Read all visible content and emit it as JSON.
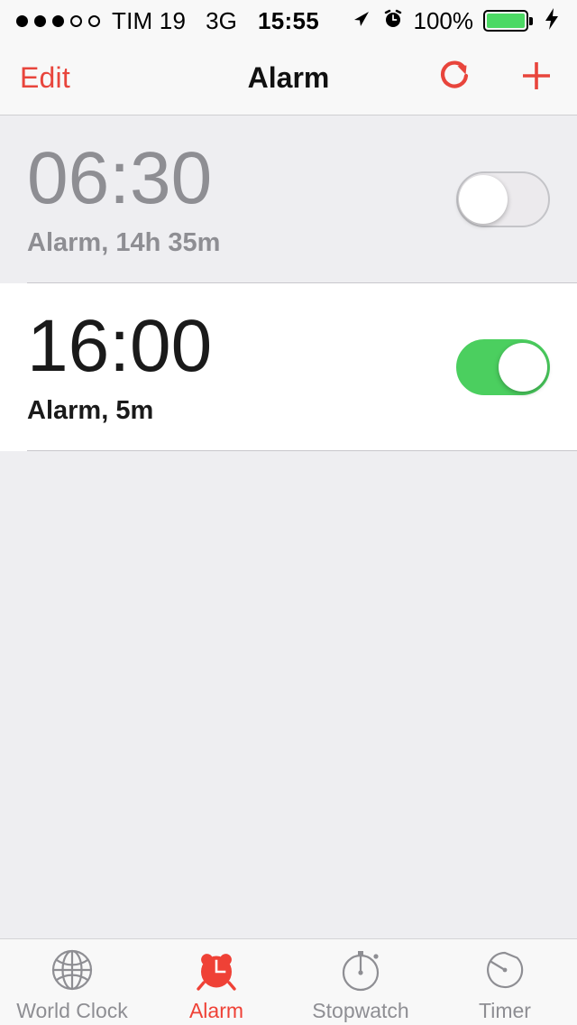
{
  "status_bar": {
    "signal_dots_total": 5,
    "signal_dots_filled": 3,
    "carrier": "TIM 19",
    "network": "3G",
    "time": "15:55",
    "battery_percent": "100%",
    "battery_level": 100,
    "charging": true,
    "location_icon": "location-arrow-icon",
    "alarm_icon": "alarm-clock-icon",
    "battery_color": "#4cd964"
  },
  "nav_bar": {
    "edit_label": "Edit",
    "title": "Alarm",
    "refresh_icon": "refresh-icon",
    "add_icon": "plus-icon",
    "accent_color": "#e8453c"
  },
  "alarms": [
    {
      "time": "06:30",
      "subtitle": "Alarm, 14h 35m",
      "enabled": false,
      "toggle_state": "off"
    },
    {
      "time": "16:00",
      "subtitle": "Alarm, 5m",
      "enabled": true,
      "toggle_state": "on",
      "toggle_color": "#4bcf5f"
    }
  ],
  "tab_bar": {
    "active_color": "#ef4136",
    "inactive_color": "#8e8e93",
    "tabs": [
      {
        "label": "World Clock",
        "icon": "globe-icon",
        "active": false
      },
      {
        "label": "Alarm",
        "icon": "alarm-clock-icon",
        "active": true
      },
      {
        "label": "Stopwatch",
        "icon": "stopwatch-icon",
        "active": false
      },
      {
        "label": "Timer",
        "icon": "timer-icon",
        "active": false
      }
    ]
  }
}
